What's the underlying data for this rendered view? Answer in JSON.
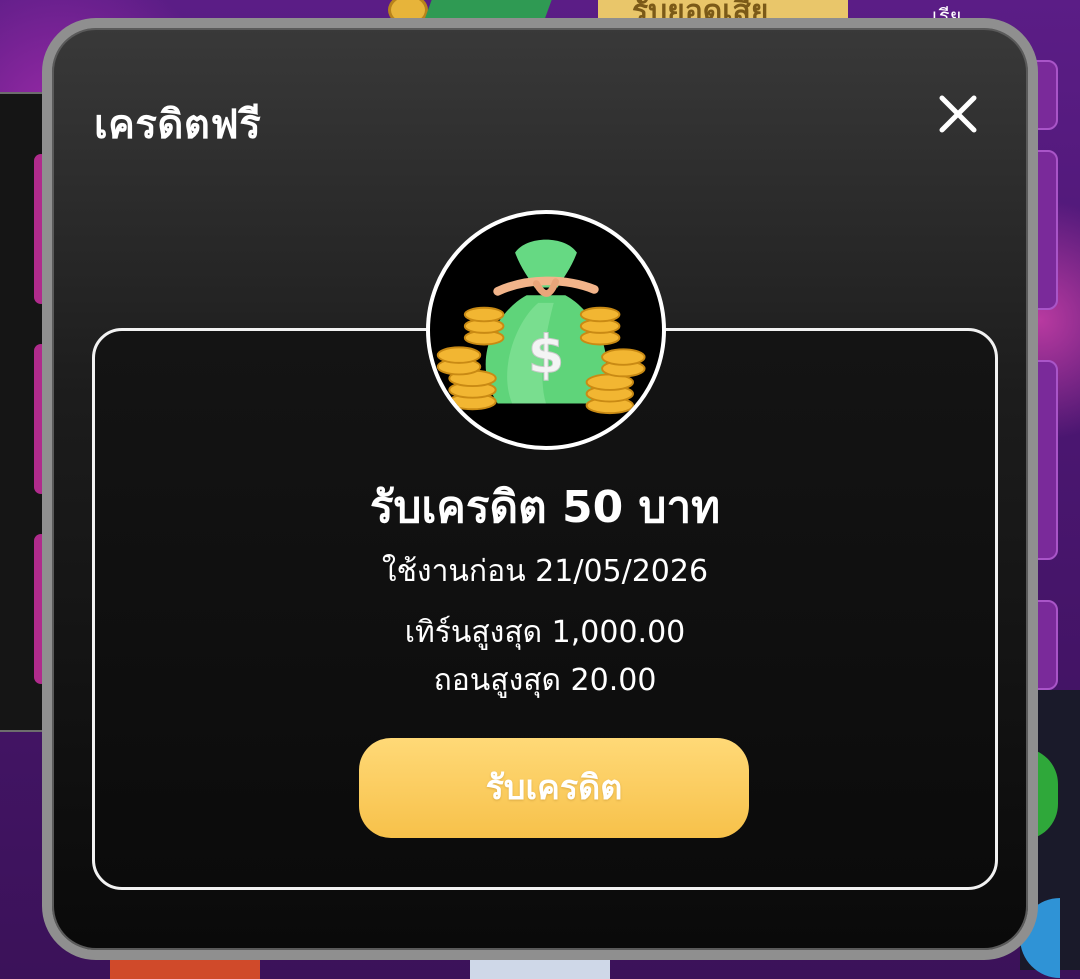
{
  "background": {
    "top_badge_text": "รับยอดเสีย",
    "top_right_text": "เรีย"
  },
  "modal": {
    "title": "เครดิตฟรี",
    "close_icon": "close-icon",
    "promo_icon": "money-bag-icon",
    "credit_heading": "รับเครดิต 50 บาท",
    "expiry": "ใช้งานก่อน 21/05/2026",
    "max_turnover": "เทิร์นสูงสุด 1,000.00",
    "max_withdraw": "ถอนสูงสุด 20.00",
    "claim_label": "รับเครดิต"
  },
  "colors": {
    "modal_border": "#8f8f8f",
    "card_border": "#f2f2f2",
    "button_gold": "#f7c14a",
    "bag_green": "#5fd47a",
    "coin_gold": "#f2b632"
  }
}
